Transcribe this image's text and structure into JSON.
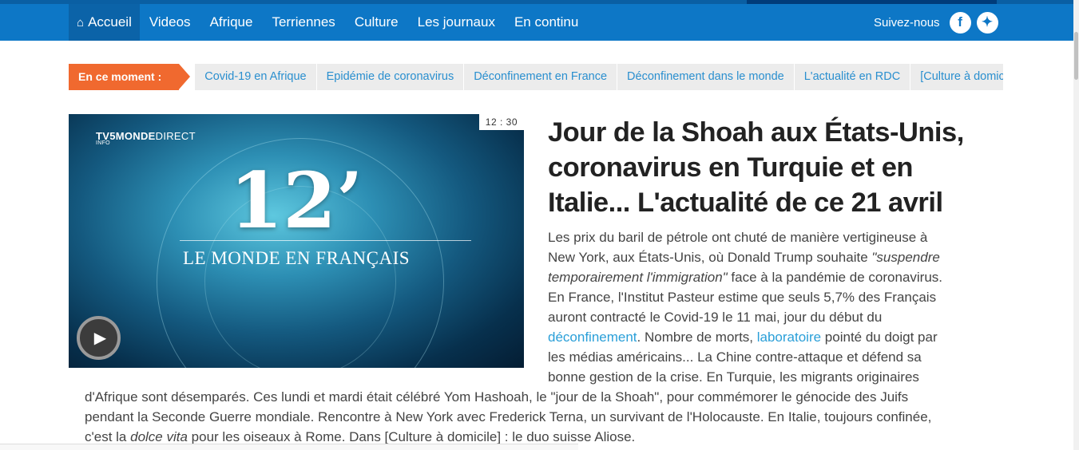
{
  "nav": {
    "items": [
      {
        "label": "Accueil",
        "active": true
      },
      {
        "label": "Videos"
      },
      {
        "label": "Afrique"
      },
      {
        "label": "Terriennes"
      },
      {
        "label": "Culture"
      },
      {
        "label": "Les journaux"
      },
      {
        "label": "En continu"
      }
    ],
    "follow_label": "Suivez-nous",
    "social": [
      "facebook-icon",
      "twitter-icon"
    ]
  },
  "colors": {
    "nav_bg": "#0d77c6",
    "trend_label_bg": "#f0692f",
    "link": "#2a9fd8"
  },
  "trending": {
    "label": "En ce moment :",
    "items": [
      "Covid-19 en Afrique",
      "Epidémie de coronavirus",
      "Déconfinement en France",
      "Déconfinement dans le monde",
      "L'actualité en RDC",
      "[Culture à domicile]"
    ]
  },
  "video": {
    "duration": "12 : 30",
    "logo_brand": "TV5MONDE",
    "logo_direct": "DIRECT",
    "logo_sub": "INFO",
    "title_big": "12’",
    "title_sub": "LE MONDE EN FRANÇAIS"
  },
  "article": {
    "headline": "Jour de la Shoah aux États-Unis, coronavirus en Turquie et en Italie... L'actualité de ce 21 avril",
    "lines": {
      "l1": "Les prix du baril de pétrole ont chuté de manière vertigineuse à",
      "l2_a": "New York, aux États-Unis, où Donald Trump souhaite ",
      "l2_q": "\"suspendre",
      "l3_q": "temporairement l'immigration\"",
      "l3_b": " face à la pandémie de coronavirus.",
      "l4": "En France, l'Institut Pasteur estime que seuls 5,7% des Français",
      "l5": "auront contracté le Covid-19 le 11 mai, jour du début du",
      "l6_link1": "déconfinement",
      "l6_b": ". Nombre de morts, ",
      "l6_link2": "laboratoire",
      "l6_c": " pointé du doigt par",
      "l7": "les médias américains... La Chine contre-attaque et défend sa",
      "l8": "bonne gestion de la crise. En Turquie, les migrants originaires",
      "l9": "d'Afrique sont désemparés. Ces lundi et mardi était célébré Yom Hashoah, le \"jour de la Shoah\", pour commémorer le génocide des Juifs",
      "l10": "pendant la Seconde Guerre mondiale. Rencontre à New York avec Frederick Terna, un survivant de l'Holocauste. En Italie, toujours confinée,",
      "l11_a": "c'est la ",
      "l11_em": "dolce vita",
      "l11_b": " pour les oiseaux à Rome. Dans [Culture à domicile] : le duo suisse Aliose."
    }
  }
}
